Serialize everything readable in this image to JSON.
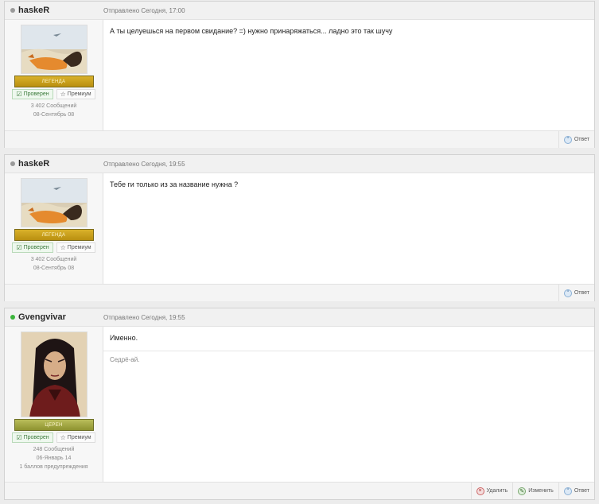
{
  "posts": [
    {
      "author": "haskeR",
      "status": "offline",
      "date": "Отправлено Сегодня, 17:00",
      "rank": "ЛЕГЕНДА",
      "verified_label": "Проверен",
      "premium_label": "Премиум",
      "messages_count": "3 402 Сообщений",
      "joined": "08-Сентябрь 08",
      "message": "А ты целуешься на первом свидание? =) нужно принаряжаться... ладно это так шучу",
      "reply_label": "Ответ"
    },
    {
      "author": "haskeR",
      "status": "offline",
      "date": "Отправлено Сегодня, 19:55",
      "rank": "ЛЕГЕНДА",
      "verified_label": "Проверен",
      "premium_label": "Премиум",
      "messages_count": "3 402 Сообщений",
      "joined": "08-Сентябрь 08",
      "message": "Тебе ги только из за название нужна ?",
      "reply_label": "Ответ"
    },
    {
      "author": "Gvengvivar",
      "status": "online",
      "date": "Отправлено Сегодня, 19:55",
      "rank": "ЦЕРЕН",
      "verified_label": "Проверен",
      "premium_label": "Премиум",
      "messages_count": "248 Сообщений",
      "joined": "06-Январь 14",
      "warnings": "1 баллов предупреждения",
      "message": "Именно.",
      "signature": "Седрё-ай.",
      "delete_label": "Удалить",
      "edit_label": "Изменить",
      "reply_label": "Ответ"
    }
  ]
}
